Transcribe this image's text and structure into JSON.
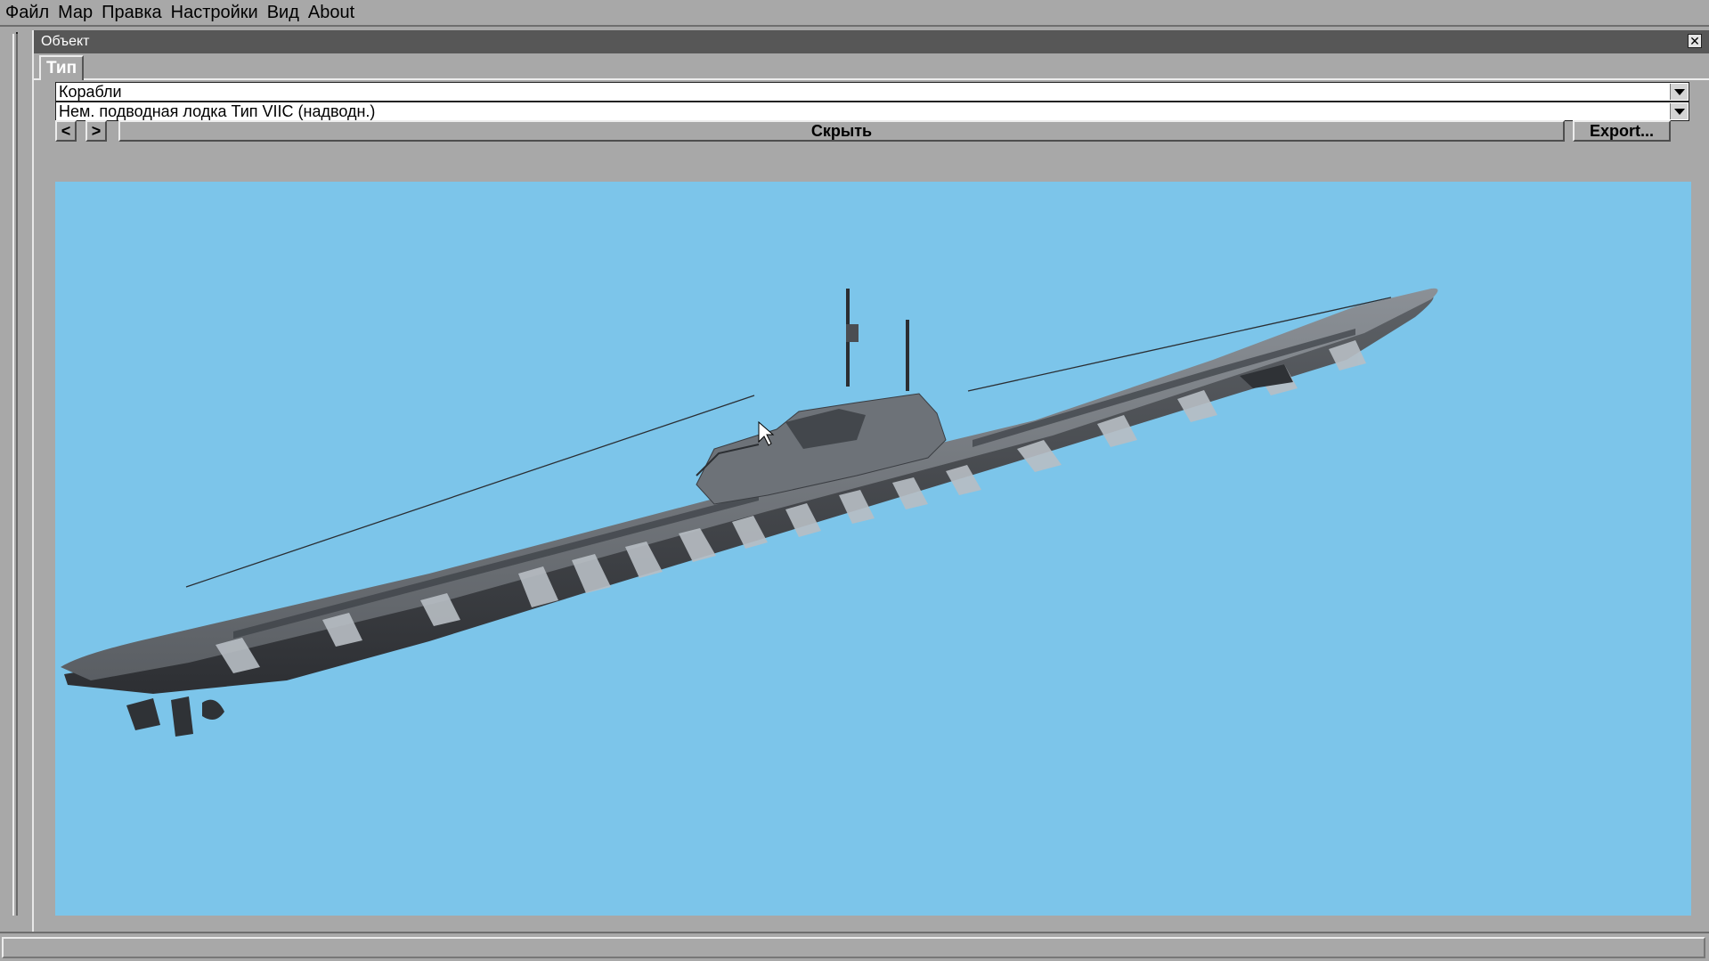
{
  "menu": {
    "items": [
      {
        "label": "Файл"
      },
      {
        "label": "Map"
      },
      {
        "label": "Правка"
      },
      {
        "label": "Настройки"
      },
      {
        "label": "Вид"
      },
      {
        "label": "About"
      }
    ]
  },
  "window": {
    "title": "Объект",
    "close_icon": "close-icon",
    "tabs": [
      {
        "label": "Тип",
        "active": true
      }
    ]
  },
  "selectors": {
    "category": {
      "value": "Корабли",
      "icon": "chevron-down-icon"
    },
    "object": {
      "value": "Нем. подводная лодка Тип VIIC (надводн.)",
      "icon": "chevron-down-icon"
    }
  },
  "toolbar": {
    "prev_label": "<",
    "next_label": ">",
    "hide_label": "Скрыть",
    "export_label": "Export..."
  },
  "viewport": {
    "background": "#7cc5ea",
    "model": "submarine-type-viic"
  }
}
